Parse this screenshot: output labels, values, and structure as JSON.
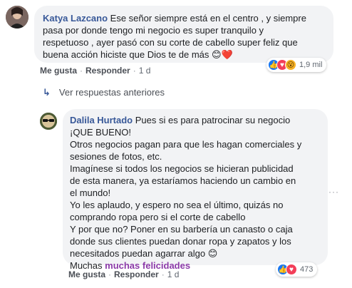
{
  "comment1": {
    "author": "Katya Lazcano",
    "lines": [
      " Ese señor siempre está en el centro , y siempre",
      "pasa por donde tengo mi negocio es super tranquilo y",
      "respetuoso , ayer pasó con su corte de cabello super feliz que",
      "buena acción hiciste que Dios te de más 😊❤️"
    ],
    "actions": {
      "like": "Me gusta",
      "reply": "Responder",
      "time": "1 d"
    },
    "reactions": {
      "count": "1,9 mil",
      "icons": [
        "like-icon",
        "love-icon",
        "wow-icon"
      ]
    }
  },
  "replies_link": {
    "label": "Ver respuestas anteriores"
  },
  "comment2": {
    "author": "Dalila Hurtado",
    "first_line": " Pues si es para patrocinar su negocio",
    "lines": [
      "¡QUE BUENO!",
      "Otros negocios pagan para que les hagan comerciales y",
      "sesiones de fotos, etc.",
      "Imagínese si todos los negocios se hicieran publicidad",
      "de esta manera, ya estaríamos haciendo un cambio en",
      "el mundo!",
      "Yo les aplaudo, y espero no sea el último, quizás no",
      "comprando ropa pero si el corte de cabello",
      "Y por que no? Poner en su barbería un canasto o caja",
      "donde sus clientes puedan donar ropa y zapatos y los",
      "necesitados puedan agarrar algo 😊"
    ],
    "last_plain": "Muchas ",
    "last_highlight": "muchas felicidades",
    "actions": {
      "like": "Me gusta",
      "reply": "Responder",
      "time": "1 d"
    },
    "reactions": {
      "count": "473",
      "icons": [
        "like-icon",
        "love-icon"
      ]
    }
  },
  "more_menu": {
    "label": "···"
  }
}
